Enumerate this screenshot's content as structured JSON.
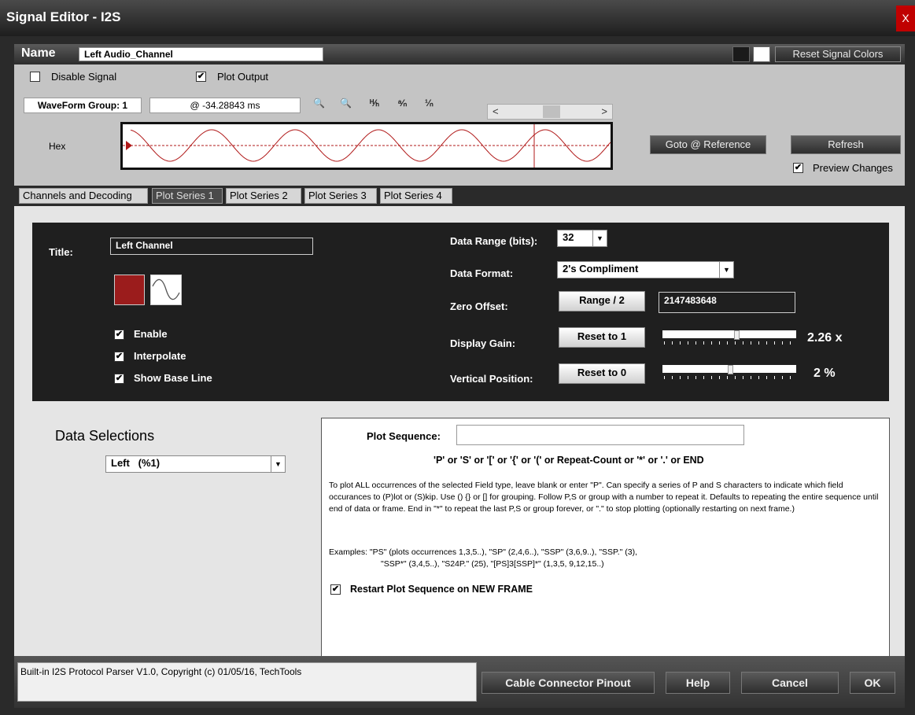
{
  "window": {
    "title": "Signal Editor - I2S",
    "close_label": "X"
  },
  "name_bar": {
    "label": "Name",
    "value": "Left Audio_Channel",
    "reset_colors": "Reset Signal Colors",
    "swatch_colors": [
      "#1a1a1a",
      "#ffffff"
    ]
  },
  "options": {
    "disable_signal": "Disable Signal",
    "disable_checked": false,
    "plot_output": "Plot Output",
    "plot_checked": true
  },
  "waveform": {
    "group_label": "WaveForm Group: 1",
    "time_value": "@ -34.28843 ms",
    "row_label": "Hex",
    "scroll_left": "<",
    "scroll_right": ">",
    "wave_color": "#b01818"
  },
  "toolbar_icons": [
    "zoom-in-icon",
    "zoom-out-icon",
    "jump-start-icon",
    "jump-prev-icon",
    "jump-next-icon"
  ],
  "buttons": {
    "goto_ref": "Goto @ Reference",
    "refresh": "Refresh",
    "preview": "Preview Changes",
    "preview_checked": true
  },
  "tabs": [
    "Channels and Decoding",
    "Plot Series 1",
    "Plot Series 2",
    "Plot Series 3",
    "Plot Series 4"
  ],
  "active_tab": 1,
  "series": {
    "title_label": "Title:",
    "title_value": "Left Channel",
    "color": "#9b1c1c",
    "enable": "Enable",
    "interpolate": "Interpolate",
    "show_base_line": "Show Base Line",
    "data_range_label": "Data Range (bits):",
    "data_range_value": "32",
    "data_format_label": "Data Format:",
    "data_format_value": "2's Compliment",
    "zero_offset_label": "Zero Offset:",
    "zero_offset_btn": "Range / 2",
    "zero_offset_value": "2147483648",
    "display_gain_label": "Display Gain:",
    "display_gain_btn": "Reset to 1",
    "display_gain_value": "2.26 x",
    "display_gain_level": 0.56,
    "vertical_pos_label": "Vertical Position:",
    "vertical_pos_btn": "Reset to 0",
    "vertical_pos_value": "2 %",
    "vertical_pos_level": 0.51
  },
  "data_selections": {
    "heading": "Data Selections",
    "value": "Left   (%1)"
  },
  "plot_sequence": {
    "label": "Plot Sequence:",
    "value": "",
    "hint": "'P' or 'S' or '[' or '{' or '(' or Repeat-Count or '*' or '.' or END",
    "para1": "To plot ALL occurrences of the selected Field type, leave blank or enter \"P\". Can specify a series of P and S characters to indicate which field occurances to (P)lot or (S)kip. Use () {} or [] for grouping.  Follow P,S or group with a number to repeat it. Defaults to repeating the entire sequence until end of data or frame. End in \"*\" to repeat the last P,S or group forever, or \".\" to stop plotting (optionally restarting on next frame.)",
    "examples1": "Examples:  \"PS\" (plots occurrences 1,3,5..), \"SP\" (2,4,6..), \"SSP\" (3,6,9..), \"SSP.\" (3),",
    "examples2": "\"SSP*\" (3,4,5..), \"S24P.\" (25), \"[PS]3[SSP]*\" (1,3,5, 9,12,15..)",
    "restart": "Restart Plot Sequence on NEW FRAME",
    "restart_checked": true
  },
  "footer": {
    "status": "Built-in I2S Protocol Parser V1.0,  Copyright (c) 01/05/16, TechTools",
    "cable": "Cable Connector Pinout",
    "help": "Help",
    "cancel": "Cancel",
    "ok": "OK"
  }
}
